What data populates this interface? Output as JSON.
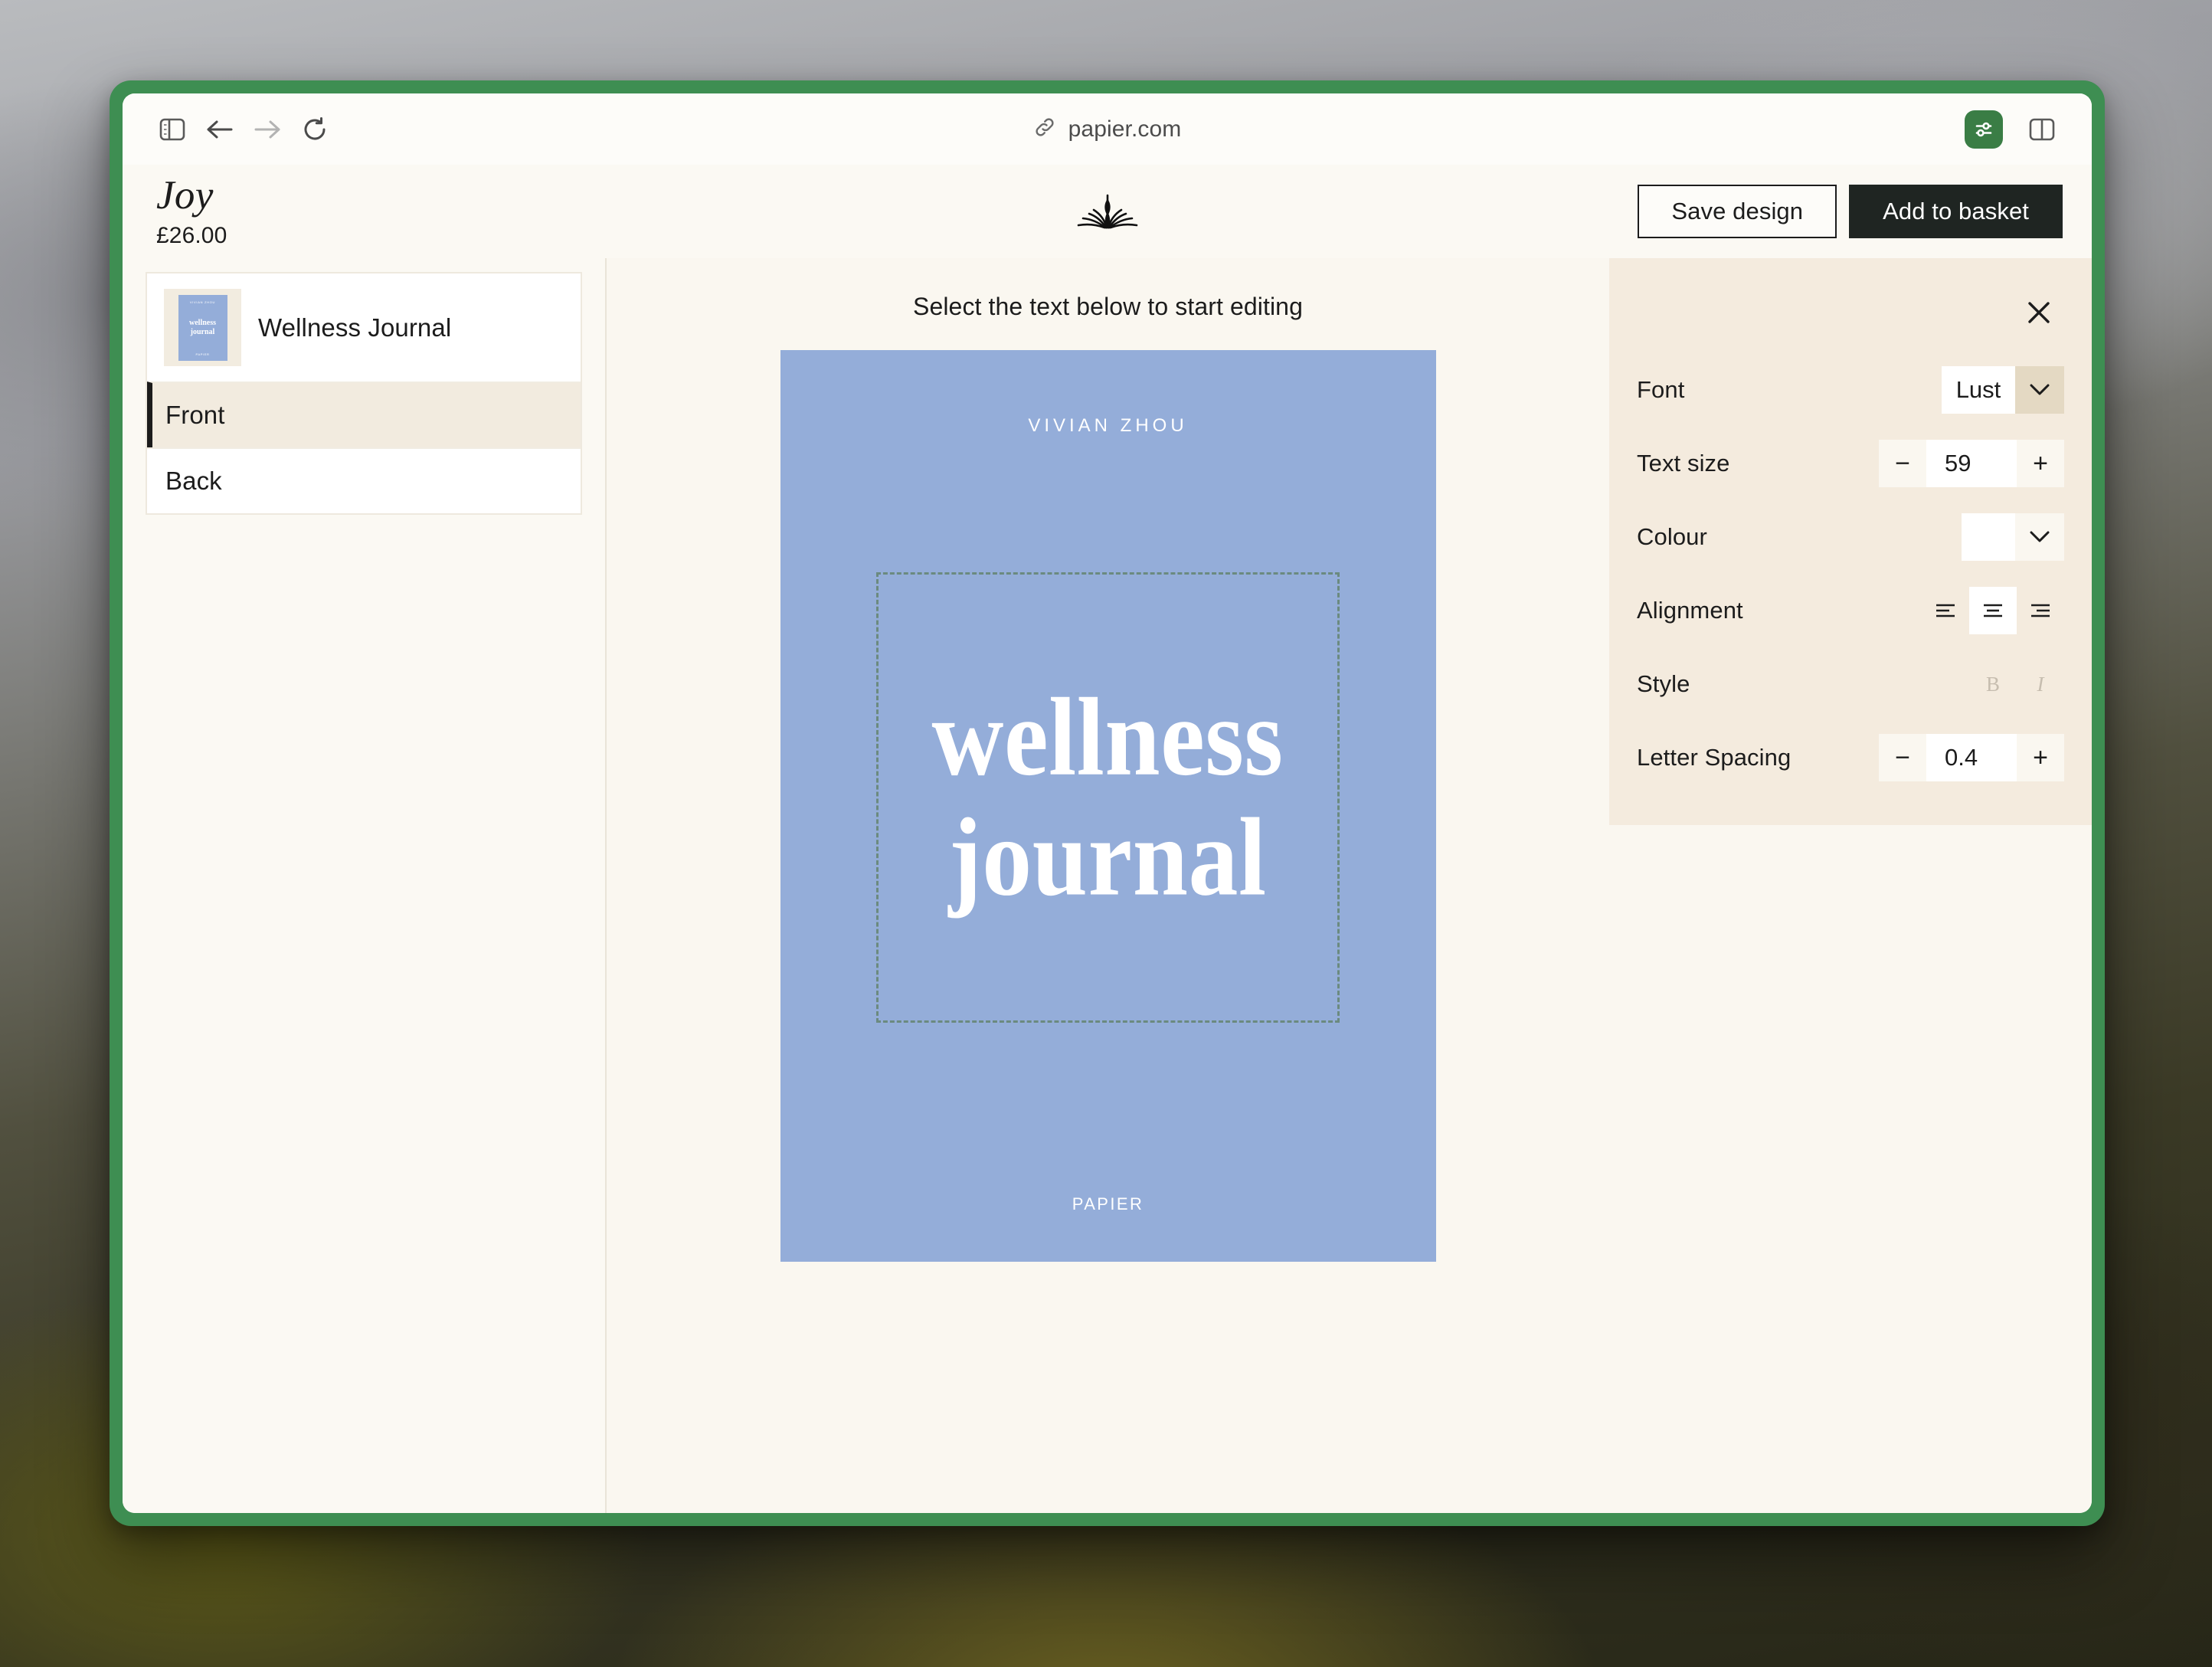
{
  "browser": {
    "url": "papier.com",
    "icons": {
      "sidebar_toggle": "sidebar-panel-icon",
      "back": "back-arrow-icon",
      "forward": "forward-arrow-icon",
      "reload": "reload-icon",
      "link": "link-icon",
      "extension": "extension-sliders-icon",
      "split_view": "split-view-icon"
    }
  },
  "header": {
    "product_title": "Joy",
    "product_price": "£26.00",
    "logo_name": "papier-logo",
    "save_label": "Save design",
    "basket_label": "Add to basket"
  },
  "sidebar": {
    "product_name": "Wellness Journal",
    "thumbnail": {
      "author": "VIVIAN ZHOU",
      "title": "wellness journal",
      "brand": "PAPIER"
    },
    "pages": [
      {
        "label": "Front",
        "selected": true
      },
      {
        "label": "Back",
        "selected": false
      }
    ]
  },
  "canvas": {
    "hint": "Select the text below to start editing",
    "next_page_icon": "chevron-right-icon",
    "cover": {
      "background_color": "#94add9",
      "author": "VIVIAN ZHOU",
      "title_line1": "wellness",
      "title_line2": "journal",
      "brand": "PAPIER",
      "text_color": "#ffffff"
    }
  },
  "text_panel": {
    "close_icon": "close-icon",
    "rows": {
      "font": {
        "label": "Font",
        "value": "Lust"
      },
      "text_size": {
        "label": "Text size",
        "value": "59",
        "minus": "−",
        "plus": "+"
      },
      "colour": {
        "label": "Colour",
        "value": "#ffffff"
      },
      "alignment": {
        "label": "Alignment",
        "options": [
          "left",
          "center",
          "right"
        ],
        "selected": "center"
      },
      "style": {
        "label": "Style",
        "bold_label": "B",
        "italic_label": "I",
        "bold_active": false,
        "italic_active": false
      },
      "letter_spacing": {
        "label": "Letter Spacing",
        "value": "0.4",
        "minus": "−",
        "plus": "+"
      }
    }
  },
  "theme": {
    "window_frame": "#3e8e52",
    "panel_beige": "#f4ebde",
    "canvas_bg": "#faf7f0",
    "accent_dark": "#1f2522"
  }
}
